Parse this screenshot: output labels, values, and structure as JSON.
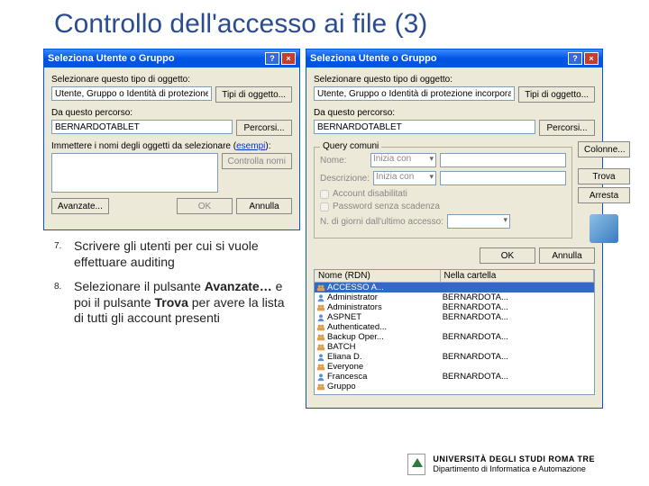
{
  "slide": {
    "title": "Controllo dell'accesso ai file (3)"
  },
  "dialog_left": {
    "title": "Seleziona Utente o Gruppo",
    "obj_type_label": "Selezionare questo tipo di oggetto:",
    "obj_type_value": "Utente, Gruppo o Identità di protezione incorporata",
    "obj_types_btn": "Tipi di oggetto...",
    "location_label": "Da questo percorso:",
    "location_value": "BERNARDOTABLET",
    "locations_btn": "Percorsi...",
    "names_label_pre": "Immettere i nomi degli oggetti da selezionare (",
    "names_label_link": "esempi",
    "names_label_post": "):",
    "check_names_btn": "Controlla nomi",
    "advanced_btn": "Avanzate...",
    "ok_btn": "OK",
    "cancel_btn": "Annulla"
  },
  "dialog_right": {
    "title": "Seleziona Utente o Gruppo",
    "obj_type_label": "Selezionare questo tipo di oggetto:",
    "obj_type_value": "Utente, Gruppo o Identità di protezione incorporata",
    "obj_types_btn": "Tipi di oggetto...",
    "location_label": "Da questo percorso:",
    "location_value": "BERNARDOTABLET",
    "locations_btn": "Percorsi...",
    "group_legend": "Query comuni",
    "name_label": "Nome:",
    "name_combo": "Inizia con",
    "desc_label": "Descrizione:",
    "desc_combo": "Inizia con",
    "chk_disabled": "Account disabilitati",
    "chk_noexpire": "Password senza scadenza",
    "days_label": "N. di giorni dall'ultimo accesso:",
    "columns_btn": "Colonne...",
    "find_btn": "Trova",
    "stop_btn": "Arresta",
    "ok_btn": "OK",
    "cancel_btn": "Annulla",
    "list_col1": "Nome (RDN)",
    "list_col2": "Nella cartella",
    "rows": [
      {
        "name": "ACCESSO A...",
        "folder": "",
        "selected": true,
        "icon": "group"
      },
      {
        "name": "Administrator",
        "folder": "BERNARDOTA...",
        "icon": "user"
      },
      {
        "name": "Administrators",
        "folder": "BERNARDOTA...",
        "icon": "group"
      },
      {
        "name": "ASPNET",
        "folder": "BERNARDOTA...",
        "icon": "user"
      },
      {
        "name": "Authenticated...",
        "folder": "",
        "icon": "group"
      },
      {
        "name": "Backup Oper...",
        "folder": "BERNARDOTA...",
        "icon": "group"
      },
      {
        "name": "BATCH",
        "folder": "",
        "icon": "group"
      },
      {
        "name": "Eliana D.",
        "folder": "BERNARDOTA...",
        "icon": "user"
      },
      {
        "name": "Everyone",
        "folder": "",
        "icon": "group"
      },
      {
        "name": "Francesca",
        "folder": "BERNARDOTA...",
        "icon": "user"
      },
      {
        "name": "Gruppo",
        "folder": "",
        "icon": "group"
      }
    ]
  },
  "instructions": {
    "items": [
      {
        "num": "7.",
        "text_pre": "Scrivere gli utenti per cui si vuole effettuare auditing"
      },
      {
        "num": "8.",
        "text_pre": "Selezionare il pulsante ",
        "bold1": "Avanzate…",
        "mid": " e poi il pulsante ",
        "bold2": "Trova",
        "post": " per avere la lista di tutti gli account presenti"
      }
    ]
  },
  "footer": {
    "uni": "UNIVERSITÀ DEGLI STUDI ROMA TRE",
    "dept": "Dipartimento di Informatica e Automazione"
  }
}
